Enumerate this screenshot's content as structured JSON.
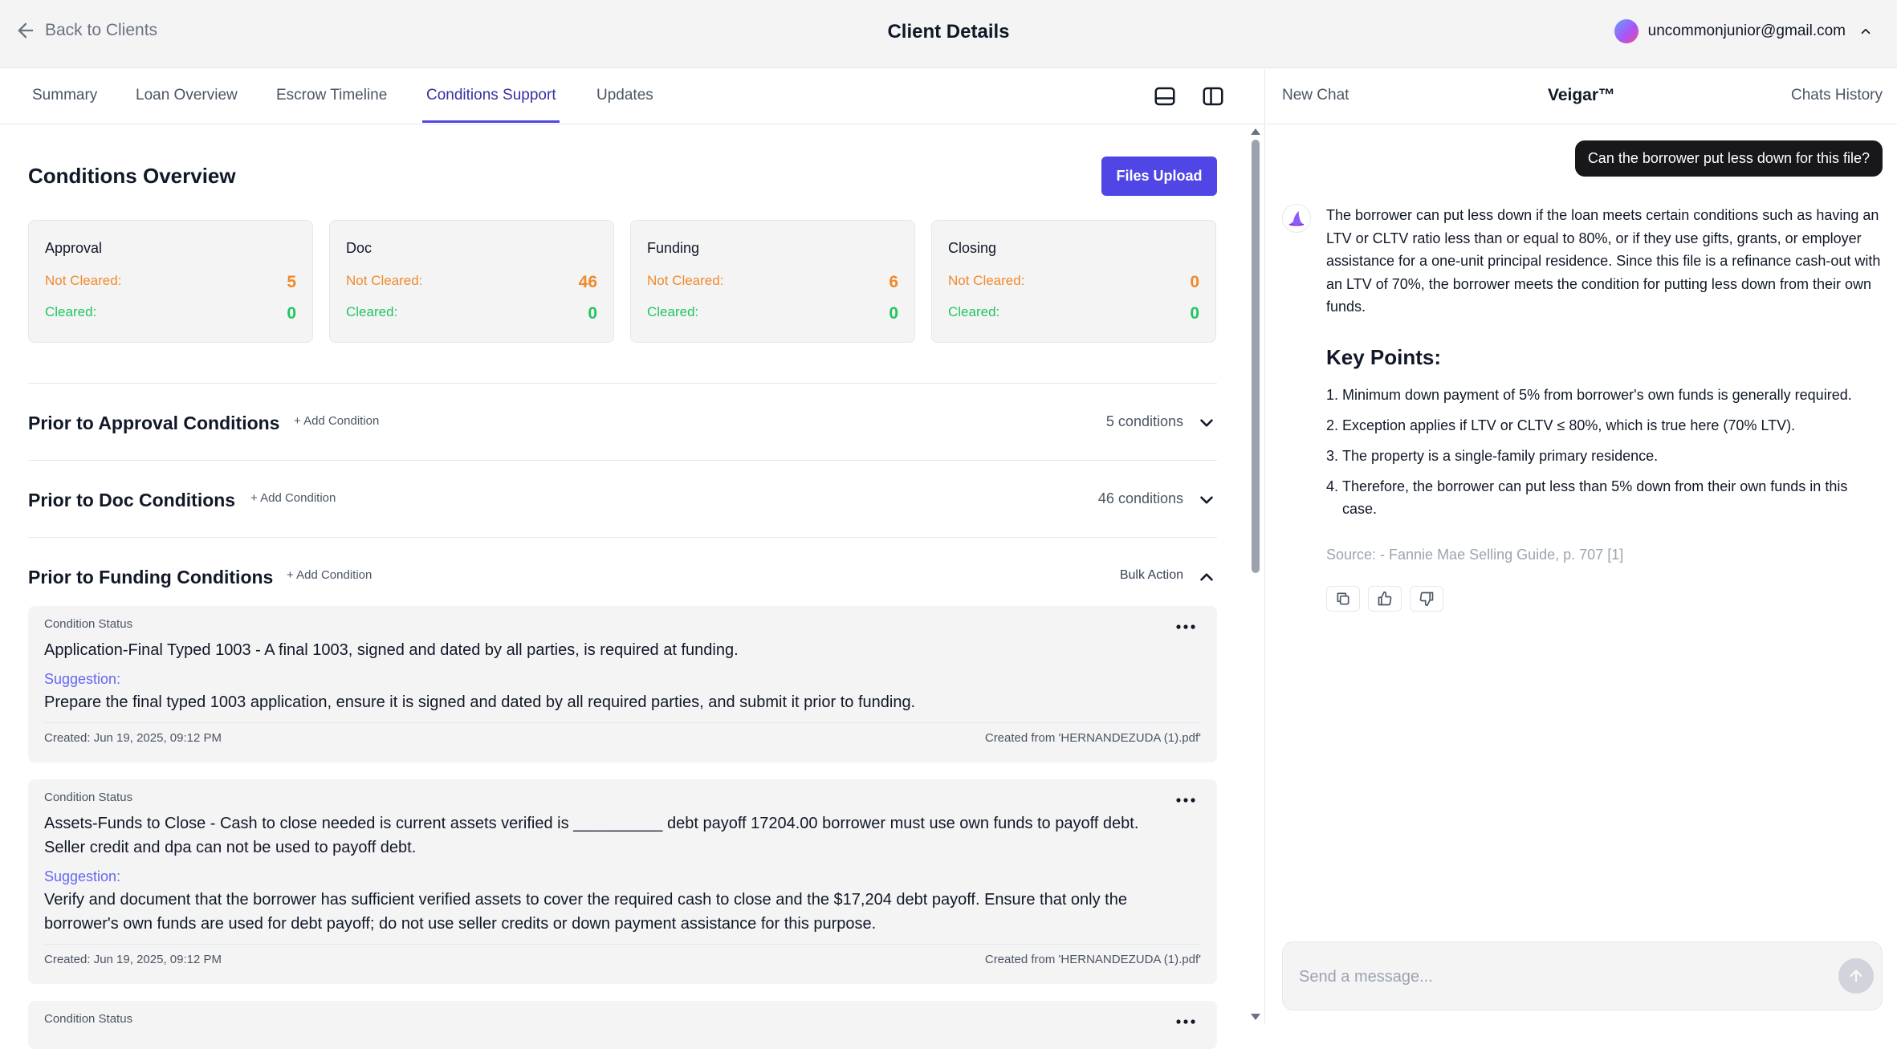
{
  "header": {
    "back_label": "Back to Clients",
    "title": "Client Details",
    "user_email": "uncommonjunior@gmail.com"
  },
  "tabs": [
    {
      "label": "Summary",
      "active": false
    },
    {
      "label": "Loan Overview",
      "active": false
    },
    {
      "label": "Escrow Timeline",
      "active": false
    },
    {
      "label": "Conditions Support",
      "active": true
    },
    {
      "label": "Updates",
      "active": false
    }
  ],
  "overview": {
    "title": "Conditions Overview",
    "upload_label": "Files Upload",
    "cards": [
      {
        "name": "Approval",
        "not_cleared_label": "Not Cleared:",
        "not_cleared": "5",
        "cleared_label": "Cleared:",
        "cleared": "0"
      },
      {
        "name": "Doc",
        "not_cleared_label": "Not Cleared:",
        "not_cleared": "46",
        "cleared_label": "Cleared:",
        "cleared": "0"
      },
      {
        "name": "Funding",
        "not_cleared_label": "Not Cleared:",
        "not_cleared": "6",
        "cleared_label": "Cleared:",
        "cleared": "0"
      },
      {
        "name": "Closing",
        "not_cleared_label": "Not Cleared:",
        "not_cleared": "0",
        "cleared_label": "Cleared:",
        "cleared": "0"
      }
    ],
    "colors": {
      "not_cleared": "#f08a2c",
      "cleared": "#22c55e",
      "accent": "#4f46e5"
    }
  },
  "sections": [
    {
      "title": "Prior to Approval Conditions",
      "add_label": "+ Add Condition",
      "right_label": "5 conditions",
      "expanded": false
    },
    {
      "title": "Prior to Doc Conditions",
      "add_label": "+ Add Condition",
      "right_label": "46 conditions",
      "expanded": false
    },
    {
      "title": "Prior to Funding Conditions",
      "add_label": "+ Add Condition",
      "right_label": "Bulk Action",
      "expanded": true
    }
  ],
  "conditions": [
    {
      "status_label": "Condition Status",
      "text": "Application-Final Typed 1003 - A final 1003, signed and dated by all parties, is required at funding.",
      "suggestion_label": "Suggestion:",
      "suggestion": "Prepare the final typed 1003 application, ensure it is signed and dated by all required parties, and submit it prior to funding.",
      "created": "Created: Jun 19, 2025, 09:12 PM",
      "source": "Created from 'HERNANDEZUDA (1).pdf'"
    },
    {
      "status_label": "Condition Status",
      "text": "Assets-Funds to Close - Cash to close needed is current assets verified is __________ debt payoff 17204.00 borrower must use own funds to payoff debt. Seller credit and dpa can not be used to payoff debt.",
      "suggestion_label": "Suggestion:",
      "suggestion": "Verify and document that the borrower has sufficient verified assets to cover the required cash to close and the $17,204 debt payoff. Ensure that only the borrower's own funds are used for debt payoff; do not use seller credits or down payment assistance for this purpose.",
      "created": "Created: Jun 19, 2025, 09:12 PM",
      "source": "Created from 'HERNANDEZUDA (1).pdf'"
    },
    {
      "status_label": "Condition Status"
    }
  ],
  "chat": {
    "new_chat_label": "New Chat",
    "brand": "Veigar™",
    "history_label": "Chats History",
    "user_message": "Can the borrower put less down for this file?",
    "bot_message": "The borrower can put less down if the loan meets certain conditions such as having an LTV or CLTV ratio less than or equal to 80%, or if they use gifts, grants, or employer assistance for a one-unit principal residence. Since this file is a refinance cash-out with an LTV of 70%, the borrower meets the condition for putting less down from their own funds.",
    "key_points_title": "Key Points:",
    "key_points": [
      {
        "num": "1.",
        "text": "Minimum down payment of 5% from borrower's own funds is generally required."
      },
      {
        "num": "2.",
        "text": "Exception applies if LTV or CLTV ≤ 80%, which is true here (70% LTV)."
      },
      {
        "num": "3.",
        "text": "The property is a single-family primary residence."
      },
      {
        "num": "4.",
        "text": "Therefore, the borrower can put less than 5% down from their own funds in this case."
      }
    ],
    "source": "Source: - Fannie Mae Selling Guide, p. 707 [1]",
    "input_placeholder": "Send a message..."
  }
}
